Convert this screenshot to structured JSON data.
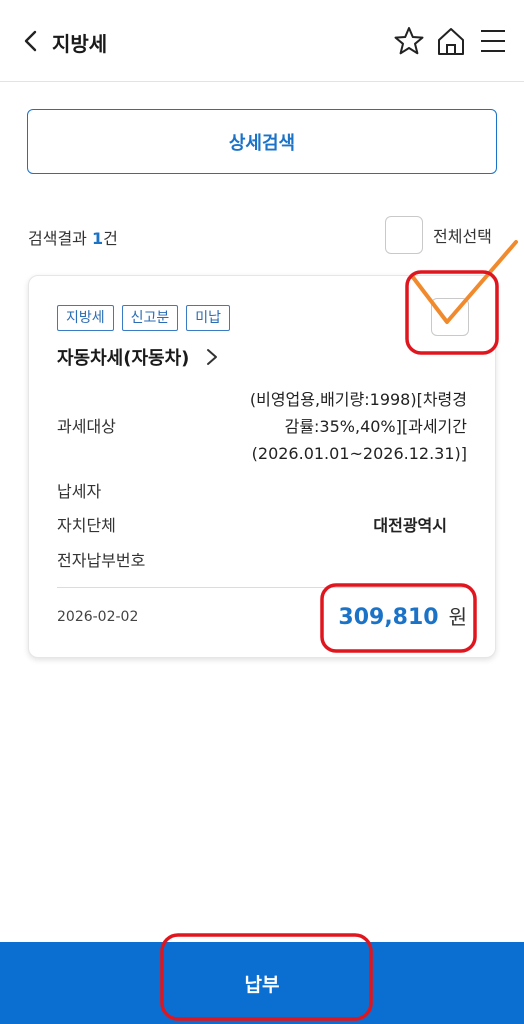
{
  "header": {
    "title": "지방세"
  },
  "search": {
    "button_label": "상세검색"
  },
  "results": {
    "prefix": "검색결과 ",
    "count": "1",
    "suffix": "건",
    "select_all_label": "전체선택"
  },
  "card": {
    "tags": [
      "지방세",
      "신고분",
      "미납"
    ],
    "title": "자동차세(자동차)",
    "rows": [
      {
        "label": "과세대상",
        "value": "(비영업용,배기량:1998)[차령경감률:35%,40%][과세기간(2026.01.01~2026.12.31)]"
      },
      {
        "label": "납세자",
        "value": ""
      },
      {
        "label": "자치단체",
        "value": "대전광역시"
      },
      {
        "label": "전자납부번호",
        "value": ""
      }
    ],
    "due_date": "2026-02-02",
    "amount": "309,810",
    "amount_unit": "원"
  },
  "footer": {
    "pay_label": "납부"
  },
  "colors": {
    "accent": "#1b73c8",
    "pay_bar": "#0a6fd1",
    "annotation_red": "#e0161f",
    "annotation_orange": "#f08a2c"
  }
}
